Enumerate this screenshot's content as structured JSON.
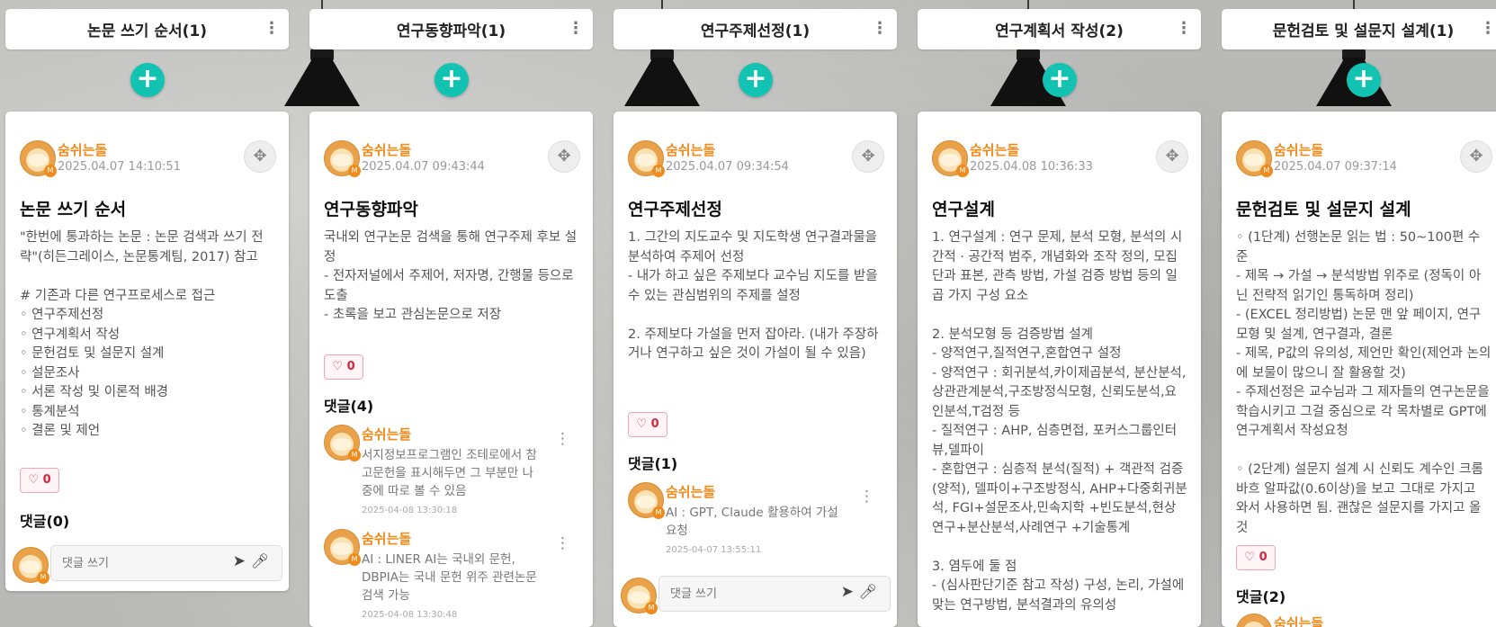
{
  "columns": [
    {
      "title": "논문 쓰기 순서(1)",
      "post": {
        "author": "숨쉬는돌",
        "date": "2025.04.07 14:10:51",
        "title": "논문 쓰기 순서",
        "body": "\"한번에 통과하는 논문 : 논문 검색과 쓰기 전략\"(히든그레이스, 논문통계팀, 2017) 참고\n\n# 기존과 다른 연구프로세스로 접근\n  ◦  연구주제선정\n  ◦  연구계획서 작성\n  ◦  문헌검토 및 설문지 설계\n  ◦  설문조사\n  ◦  서론 작성 및 이론적 배경\n  ◦  통계분석\n  ◦  결론 및 제언",
        "likes": "0",
        "comment_count": "댓글(0)"
      },
      "comments": [],
      "input_placeholder": "댓글 쓰기"
    },
    {
      "title": "연구동향파악(1)",
      "post": {
        "author": "숨쉬는돌",
        "date": "2025.04.07 09:43:44",
        "title": "연구동향파악",
        "body": "국내외 연구논문 검색을 통해 연구주제 후보 설정\n  - 전자저널에서 주제어, 저자명, 간행물 등으로 도출\n  - 초록을 보고 관심논문으로 저장",
        "likes": "0",
        "comment_count": "댓글(4)"
      },
      "comments": [
        {
          "author": "숨쉬는돌",
          "text": "서지정보프로그램인 조테로에서 참고문헌을 표시해두면 그 부분만 나중에 따로 볼 수 있음",
          "date": "2025-04-08 13:30:18"
        },
        {
          "author": "숨쉬는돌",
          "text": "AI : LINER AI는 국내외 문헌, DBPIA는 국내 문헌 위주 관련논문 검색 가능",
          "date": "2025-04-08 13:30:48"
        }
      ]
    },
    {
      "title": "연구주제선정(1)",
      "post": {
        "author": "숨쉬는돌",
        "date": "2025.04.07 09:34:54",
        "title": "연구주제선정",
        "body": "1.  그간의 지도교수 및 지도학생 연구결과물을 분석하여 주제어 선정\n - 내가 하고 싶은 주제보다 교수님 지도를 받을 수 있는 관심범위의 주제를 설정\n\n2. 주제보다 가설을 먼저 잡아라. (내가 주장하거나 연구하고 싶은 것이 가설이 될 수 있음)",
        "likes": "0",
        "comment_count": "댓글(1)"
      },
      "comments": [
        {
          "author": "숨쉬는돌",
          "text": "AI : GPT, Claude 활용하여 가설 요청",
          "date": "2025-04-07 13:55:11"
        }
      ],
      "input_placeholder": "댓글 쓰기"
    },
    {
      "title": "연구계획서 작성(2)",
      "post": {
        "author": "숨쉬는돌",
        "date": "2025.04.08 10:36:33",
        "title": "연구설계",
        "body": "1.  연구설계 : 연구 문제, 분석 모형, 분석의 시간적 · 공간적 범주, 개념화와 조작 정의, 모집단과 표본, 관측 방법, 가설 검증 방법 등의 일곱 가지 구성 요소\n\n2. 분석모형 등 검증방법 설계\n - 양적연구,질적연구,혼합연구 설정\n - 양적연구 :  회귀분석,카이제곱분석, 분산분석,상관관계분석,구조방정식모형, 신뢰도분석,요인분석,T검정 등\n  - 질적연구 : AHP, 심층면접, 포커스그룹인터뷰,델파이\n  - 혼합연구 : 심층적 분석(질적) + 객관적 검증(양적), 델파이+구조방정식, AHP+다중회귀분석, FGI+설문조사,민속지학 +빈도분석,현상연구+분산분석,사례연구 +기술통계\n\n3. 염두에 둘 점\n  - (심사판단기준 참고 작성) 구성, 논리, 가설에 맞는 연구방법, 분석결과의 유의성"
      }
    },
    {
      "title": "문헌검토 및 설문지 설계(1)",
      "post": {
        "author": "숨쉬는돌",
        "date": "2025.04.07 09:37:14",
        "title": "문헌검토 및 설문지 설계",
        "body": "  ◦  (1단계) 선행논문 읽는 법 : 50~100편 수준\n  - 제목 → 가설 → 분석방법 위주로 (정독이 아닌 전략적 읽기인 통독하며 정리)\n  - (EXCEL 정리방법) 논문 맨 앞 페이지, 연구모형 및 설계, 연구결과, 결론\n  - 제목, P값의 유의성, 제언만 확인(제언과 논의에 보물이 많으니 잘 활용할 것)\n  - 주제선정은 교수님과 그 제자들의 연구논문을 학습시키고 그걸 중심으로 각 목차별로 GPT에 연구계획서 작성요청\n\n  ◦  (2단계) 설문지 설계 시 신뢰도 계수인 크롬바흐 알파값(0.6이상)을 보고 그대로 가지고 와서 사용하면 됨. 괜찮은 설문지를 가지고 올 것",
        "likes": "0",
        "comment_count": "댓글(2)"
      },
      "comments": [
        {
          "author": "숨쉬는돌"
        }
      ]
    }
  ]
}
